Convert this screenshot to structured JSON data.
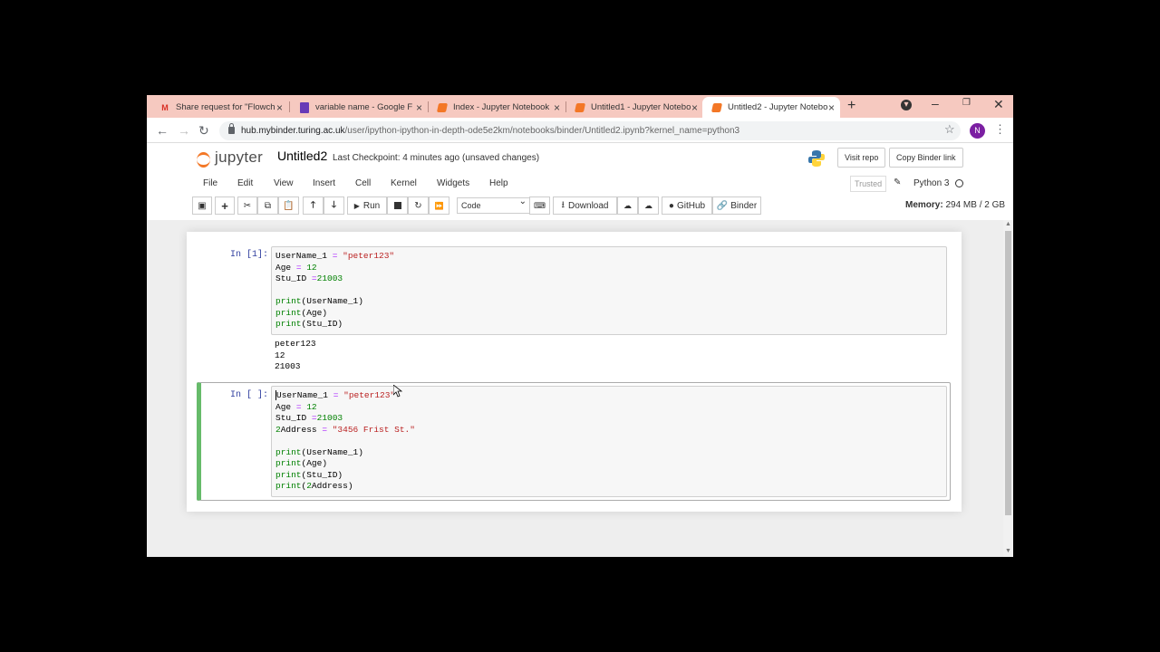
{
  "browser": {
    "tabs": [
      {
        "title": "Share request for \"Flowch",
        "icon": "gmail-icon"
      },
      {
        "title": "variable name - Google F",
        "icon": "google-forms-icon"
      },
      {
        "title": "Index - Jupyter Notebook",
        "icon": "jupyter-icon"
      },
      {
        "title": "Untitled1 - Jupyter Notebo",
        "icon": "jupyter-icon"
      },
      {
        "title": "Untitled2 - Jupyter Notebo",
        "icon": "jupyter-icon",
        "active": true
      }
    ],
    "url_host": "hub.mybinder.turing.ac.uk",
    "url_path": "/user/ipython-ipython-in-depth-ode5e2km/notebooks/binder/Untitled2.ipynb?kernel_name=python3",
    "profile_initial": "N"
  },
  "jupyter": {
    "logo_text": "jupyter",
    "notebook_name": "Untitled2",
    "checkpoint": "Last Checkpoint: 4 minutes ago",
    "save_status": "(unsaved changes)",
    "visit_repo": "Visit repo",
    "copy_binder_link": "Copy Binder link",
    "menu": [
      "File",
      "Edit",
      "View",
      "Insert",
      "Cell",
      "Kernel",
      "Widgets",
      "Help"
    ],
    "trusted": "Trusted",
    "kernel": "Python 3",
    "toolbar": {
      "run": "Run",
      "cell_type": "Code",
      "download": "Download",
      "github": "GitHub",
      "binder": "Binder"
    },
    "memory_label": "Memory:",
    "memory_value": "294 MB / 2 GB"
  },
  "cells": [
    {
      "prompt": "In [1]:",
      "code": [
        [
          [
            "UserName_1 ",
            ""
          ],
          [
            "=",
            "op"
          ],
          [
            " ",
            ""
          ],
          [
            "\"peter123\"",
            "str"
          ]
        ],
        [
          [
            "Age ",
            ""
          ],
          [
            "=",
            "op"
          ],
          [
            " ",
            ""
          ],
          [
            "12",
            "num"
          ]
        ],
        [
          [
            "Stu_ID ",
            ""
          ],
          [
            "=",
            "op"
          ],
          [
            "21003",
            "num"
          ]
        ],
        [],
        [
          [
            "print",
            "kw"
          ],
          [
            "(UserName_1)",
            ""
          ]
        ],
        [
          [
            "print",
            "kw"
          ],
          [
            "(Age)",
            ""
          ]
        ],
        [
          [
            "print",
            "kw"
          ],
          [
            "(Stu_ID)",
            ""
          ]
        ]
      ],
      "output": [
        "peter123",
        "12",
        "21003"
      ]
    },
    {
      "prompt": "In [ ]:",
      "code": [
        [
          [
            "UserName_1 ",
            ""
          ],
          [
            "=",
            "op"
          ],
          [
            " ",
            ""
          ],
          [
            "\"peter123\"",
            "str"
          ]
        ],
        [
          [
            "Age ",
            ""
          ],
          [
            "=",
            "op"
          ],
          [
            " ",
            ""
          ],
          [
            "12",
            "num"
          ]
        ],
        [
          [
            "Stu_ID ",
            ""
          ],
          [
            "=",
            "op"
          ],
          [
            "21003",
            "num"
          ]
        ],
        [
          [
            "2",
            "num"
          ],
          [
            "Address ",
            ""
          ],
          [
            "=",
            "op"
          ],
          [
            " ",
            ""
          ],
          [
            "\"3456 Frist St.\"",
            "str"
          ]
        ],
        [],
        [
          [
            "print",
            "kw"
          ],
          [
            "(UserName_1)",
            ""
          ]
        ],
        [
          [
            "print",
            "kw"
          ],
          [
            "(Age)",
            ""
          ]
        ],
        [
          [
            "print",
            "kw"
          ],
          [
            "(Stu_ID)",
            ""
          ]
        ],
        [
          [
            "print",
            "kw"
          ],
          [
            "(",
            ""
          ],
          [
            "2",
            "num"
          ],
          [
            "Address)",
            ""
          ]
        ]
      ],
      "output": []
    }
  ]
}
